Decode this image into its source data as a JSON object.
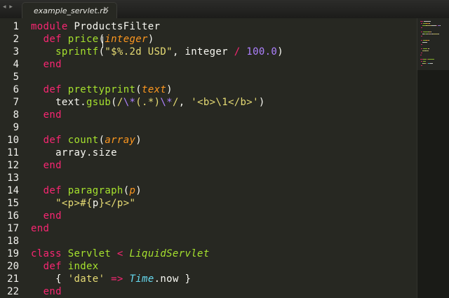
{
  "tabbar": {
    "nav_arrows": "◂ ▸",
    "active_tab": {
      "title": "example_servlet.rb",
      "close_glyph": "✕"
    }
  },
  "editor": {
    "lines": [
      {
        "n": "1",
        "tokens": [
          [
            "kw",
            "module"
          ],
          [
            "plain",
            " ProductsFilter"
          ]
        ]
      },
      {
        "n": "2",
        "tokens": [
          [
            "plain",
            "  "
          ],
          [
            "kw",
            "def"
          ],
          [
            "plain",
            " "
          ],
          [
            "fn",
            "price"
          ],
          [
            "plain",
            "("
          ],
          [
            "par",
            "integer"
          ],
          [
            "plain",
            ")"
          ]
        ]
      },
      {
        "n": "3",
        "tokens": [
          [
            "plain",
            "    "
          ],
          [
            "fn",
            "sprintf"
          ],
          [
            "plain",
            "("
          ],
          [
            "str",
            "\"$%.2d USD\""
          ],
          [
            "plain",
            ", integer "
          ],
          [
            "op",
            "/"
          ],
          [
            "plain",
            " "
          ],
          [
            "num",
            "100.0"
          ],
          [
            "plain",
            ")"
          ]
        ]
      },
      {
        "n": "4",
        "tokens": [
          [
            "plain",
            "  "
          ],
          [
            "kw",
            "end"
          ]
        ]
      },
      {
        "n": "5",
        "tokens": []
      },
      {
        "n": "6",
        "tokens": [
          [
            "plain",
            "  "
          ],
          [
            "kw",
            "def"
          ],
          [
            "plain",
            " "
          ],
          [
            "fn",
            "prettyprint"
          ],
          [
            "plain",
            "("
          ],
          [
            "par",
            "text"
          ],
          [
            "plain",
            ")"
          ]
        ]
      },
      {
        "n": "7",
        "tokens": [
          [
            "plain",
            "    text."
          ],
          [
            "fn",
            "gsub"
          ],
          [
            "plain",
            "("
          ],
          [
            "str",
            "/"
          ],
          [
            "esc",
            "\\*"
          ],
          [
            "str",
            "(.*)"
          ],
          [
            "esc",
            "\\*"
          ],
          [
            "str",
            "/"
          ],
          [
            "plain",
            ", "
          ],
          [
            "str",
            "'<b>\\1</b>'"
          ],
          [
            "plain",
            ")"
          ]
        ]
      },
      {
        "n": "8",
        "tokens": [
          [
            "plain",
            "  "
          ],
          [
            "kw",
            "end"
          ]
        ]
      },
      {
        "n": "9",
        "tokens": []
      },
      {
        "n": "10",
        "tokens": [
          [
            "plain",
            "  "
          ],
          [
            "kw",
            "def"
          ],
          [
            "plain",
            " "
          ],
          [
            "fn",
            "count"
          ],
          [
            "plain",
            "("
          ],
          [
            "par",
            "array"
          ],
          [
            "plain",
            ")"
          ]
        ]
      },
      {
        "n": "11",
        "tokens": [
          [
            "plain",
            "    array.size"
          ]
        ]
      },
      {
        "n": "12",
        "tokens": [
          [
            "plain",
            "  "
          ],
          [
            "kw",
            "end"
          ]
        ]
      },
      {
        "n": "13",
        "tokens": []
      },
      {
        "n": "14",
        "tokens": [
          [
            "plain",
            "  "
          ],
          [
            "kw",
            "def"
          ],
          [
            "plain",
            " "
          ],
          [
            "fn",
            "paragraph"
          ],
          [
            "plain",
            "("
          ],
          [
            "par",
            "p"
          ],
          [
            "plain",
            ")"
          ]
        ]
      },
      {
        "n": "15",
        "tokens": [
          [
            "plain",
            "    "
          ],
          [
            "str",
            "\"<p>#{"
          ],
          [
            "plain",
            "p"
          ],
          [
            "str",
            "}</p>\""
          ]
        ]
      },
      {
        "n": "16",
        "tokens": [
          [
            "plain",
            "  "
          ],
          [
            "kw",
            "end"
          ]
        ]
      },
      {
        "n": "17",
        "tokens": [
          [
            "kw",
            "end"
          ]
        ]
      },
      {
        "n": "18",
        "tokens": []
      },
      {
        "n": "19",
        "tokens": [
          [
            "kw",
            "class"
          ],
          [
            "plain",
            " "
          ],
          [
            "fn",
            "Servlet"
          ],
          [
            "plain",
            " "
          ],
          [
            "op",
            "<"
          ],
          [
            "plain",
            " "
          ],
          [
            "sup",
            "LiquidServlet"
          ]
        ]
      },
      {
        "n": "20",
        "tokens": [
          [
            "plain",
            "  "
          ],
          [
            "kw",
            "def"
          ],
          [
            "plain",
            " "
          ],
          [
            "fn",
            "index"
          ]
        ]
      },
      {
        "n": "21",
        "tokens": [
          [
            "plain",
            "    { "
          ],
          [
            "str",
            "'date'"
          ],
          [
            "plain",
            " "
          ],
          [
            "op",
            "=>"
          ],
          [
            "plain",
            " "
          ],
          [
            "type",
            "Time"
          ],
          [
            "plain",
            ".now }"
          ]
        ]
      },
      {
        "n": "22",
        "tokens": [
          [
            "plain",
            "  "
          ],
          [
            "kw",
            "end"
          ]
        ]
      }
    ]
  },
  "colors": {
    "background": "#272822",
    "keyword": "#f92672",
    "function": "#a6e22e",
    "parameter": "#fd971f",
    "string": "#e6db74",
    "number": "#ae81ff",
    "type": "#66d9ef",
    "text": "#f8f8f2"
  }
}
